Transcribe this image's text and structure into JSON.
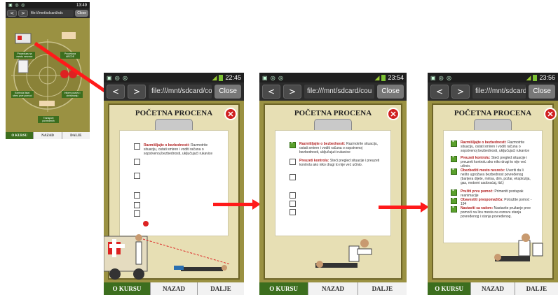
{
  "statusbar": {
    "left_icons": "▣ ◎ ◎",
    "signal": "◢",
    "times": [
      "13:49",
      "22:45",
      "23:54",
      "23:56"
    ]
  },
  "browser": {
    "back": "<",
    "forward": ">",
    "url_small": "file:///mnt/sdcard/sdc",
    "url": "file:///mnt/sdcard/cou",
    "close": "Close"
  },
  "screen1": {
    "hub_labels": [
      "Procedura na mestu nesrece",
      "Procedura ABCDE",
      "Kontrola lista i stres prve pomoci",
      "Inform pozivu i obrisinanju",
      "Transport povredenih"
    ]
  },
  "screen": {
    "title": "POČETNA PROCENA",
    "close_icon": "✕"
  },
  "checklist": [
    {
      "title": "Razmišljajte o bezbednosti:",
      "text": "Razmotrite situaciju, ostati smiren i voditi računa o sopstvenoj bezbednosti, uključujući rukavice"
    },
    {
      "title": "Preuzeti kontrolu:",
      "text": "Steći pregled situacije i preuzeti kontrolu ako niko drugi to nije već učinio."
    },
    {
      "title": "Obezbediti mesto nesreće:",
      "text": "Uveriti da li nešto ugrožava bezbednost povređenog (barijera dijete, mirisa, dim, požar, eksplozija, gas, motorni saobraćaj, itd.)"
    },
    {
      "title": "Pružiti prvu pomoć:",
      "text": "Primeniti postupak reanimacije"
    },
    {
      "title": "Obavestiti prvopomažiča:",
      "text": "Potražite pomoć - 194"
    },
    {
      "title": "Nastaviti sa radom:",
      "text": "Nastavite pružanje prve pomoći na licu mesta na osnovu stanja povređenog i stanja povređenog."
    }
  ],
  "tabs": {
    "about": "O KURSU",
    "back": "NAZAD",
    "next": "DALJE"
  },
  "colors": {
    "accent_arrow": "#ff1a1a",
    "frame": "#7a7330",
    "check_on": "#5aa02c",
    "tab_active": "#3c6e1e",
    "title_red": "#b01e1e"
  }
}
